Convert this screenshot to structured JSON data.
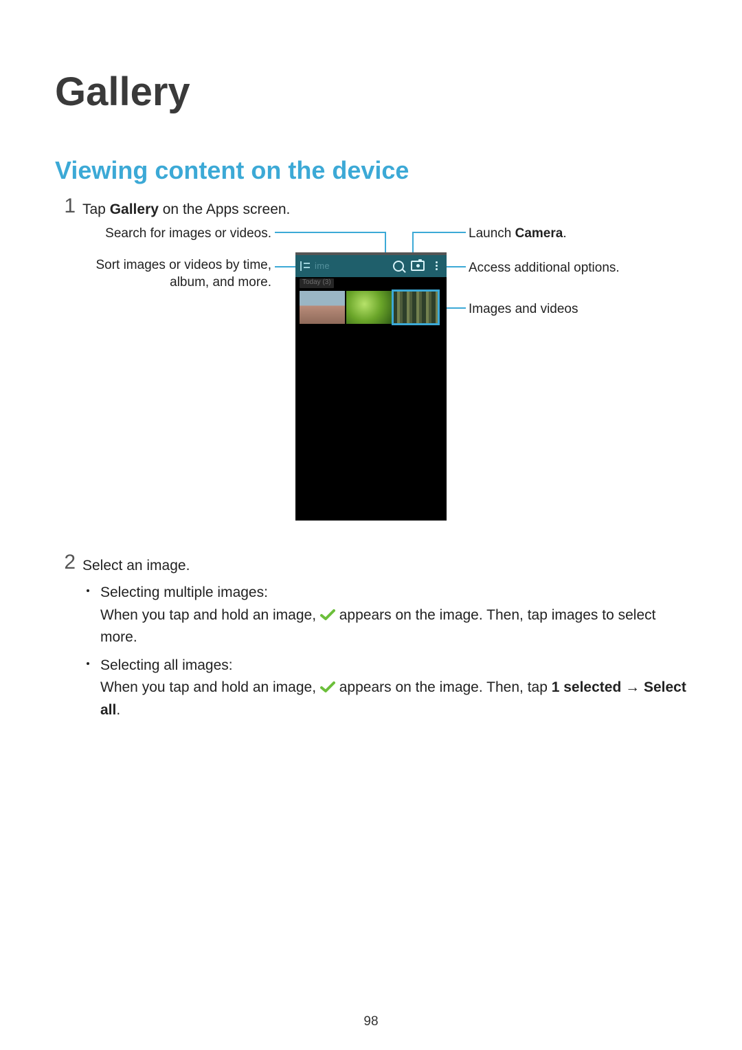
{
  "page": {
    "title": "Gallery",
    "section": "Viewing content on the device",
    "page_number": "98"
  },
  "step1": {
    "num": "1",
    "text_before": "Tap ",
    "bold": "Gallery",
    "text_after": " on the Apps screen."
  },
  "callouts": {
    "search": "Search for images or videos.",
    "sort_line1": "Sort images or videos by time,",
    "sort_line2": "album, and more.",
    "camera_before": "Launch ",
    "camera_bold": "Camera",
    "camera_after": ".",
    "options": "Access additional options.",
    "thumbs": "Images and videos"
  },
  "gallery_ui": {
    "toolbar_label": "ime",
    "date_strip": "Today (3)"
  },
  "step2": {
    "num": "2",
    "text": "Select an image.",
    "bullet1_head": "Selecting multiple images:",
    "bullet1_before": "When you tap and hold an image, ",
    "bullet1_after": " appears on the image. Then, tap images to select more.",
    "bullet2_head": "Selecting all images:",
    "bullet2_before": "When you tap and hold an image, ",
    "bullet2_mid": " appears on the image. Then, tap ",
    "bullet2_bold1": "1 selected",
    "bullet2_arrow": " → ",
    "bullet2_bold2": "Select all",
    "bullet2_end": "."
  }
}
